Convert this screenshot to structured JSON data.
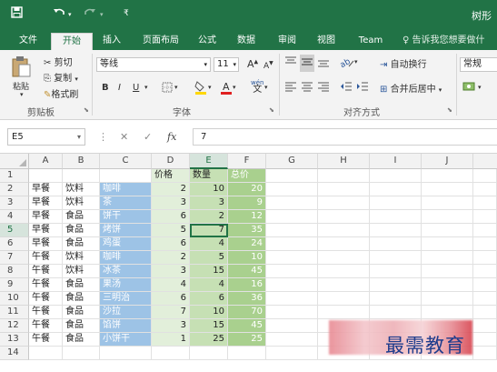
{
  "titlebar": {
    "save_icon": "save-icon",
    "undo_icon": "undo-icon",
    "redo_icon": "redo-icon",
    "customize_icon": "customize-qat-icon",
    "doc_title": "树形"
  },
  "tabs": [
    "文件",
    "开始",
    "插入",
    "页面布局",
    "公式",
    "数据",
    "审阅",
    "视图",
    "Team"
  ],
  "active_tab": "开始",
  "tell_me": "告诉我您想要做什",
  "ribbon": {
    "clipboard": {
      "paste": "粘贴",
      "cut": "剪切",
      "copy": "复制",
      "format_painter": "格式刷",
      "group_label": "剪贴板"
    },
    "font": {
      "font_name": "等线",
      "font_size": "11",
      "grow": "A",
      "shrink": "A",
      "bold": "B",
      "italic": "I",
      "underline": "U",
      "wen": "wén",
      "group_label": "字体"
    },
    "alignment": {
      "wrap_text": "自动换行",
      "merge_center": "合并后居中",
      "group_label": "对齐方式"
    },
    "number": {
      "format": "常规"
    }
  },
  "formula_bar": {
    "name_box": "E5",
    "fx": "fx",
    "value": "7"
  },
  "columns": [
    "A",
    "B",
    "C",
    "D",
    "E",
    "F",
    "G",
    "H",
    "I",
    "J"
  ],
  "selected_column": "E",
  "row_numbers": [
    "1",
    "2",
    "3",
    "4",
    "5",
    "6",
    "7",
    "8",
    "9",
    "10",
    "11",
    "12",
    "13",
    "14"
  ],
  "selected_row": "5",
  "headers": {
    "d": "价格",
    "e": "数量",
    "f": "总价"
  },
  "rows": [
    {
      "a": "早餐",
      "b": "饮料",
      "c": "咖啡",
      "d": "2",
      "e": "10",
      "f": "20"
    },
    {
      "a": "早餐",
      "b": "饮料",
      "c": "茶",
      "d": "3",
      "e": "3",
      "f": "9"
    },
    {
      "a": "早餐",
      "b": "食品",
      "c": "饼干",
      "d": "6",
      "e": "2",
      "f": "12"
    },
    {
      "a": "早餐",
      "b": "食品",
      "c": "烤饼",
      "d": "5",
      "e": "7",
      "f": "35"
    },
    {
      "a": "早餐",
      "b": "食品",
      "c": "鸡蛋",
      "d": "6",
      "e": "4",
      "f": "24"
    },
    {
      "a": "午餐",
      "b": "饮料",
      "c": "咖啡",
      "d": "2",
      "e": "5",
      "f": "10"
    },
    {
      "a": "午餐",
      "b": "饮料",
      "c": "冰茶",
      "d": "3",
      "e": "15",
      "f": "45"
    },
    {
      "a": "午餐",
      "b": "食品",
      "c": "果汤",
      "d": "4",
      "e": "4",
      "f": "16"
    },
    {
      "a": "午餐",
      "b": "食品",
      "c": "三明治",
      "d": "6",
      "e": "6",
      "f": "36"
    },
    {
      "a": "午餐",
      "b": "食品",
      "c": "沙拉",
      "d": "7",
      "e": "10",
      "f": "70"
    },
    {
      "a": "午餐",
      "b": "食品",
      "c": "馅饼",
      "d": "3",
      "e": "15",
      "f": "45"
    },
    {
      "a": "午餐",
      "b": "食品",
      "c": "小饼干",
      "d": "1",
      "e": "25",
      "f": "25"
    }
  ],
  "watermark": "最需教育",
  "colors": {
    "brand": "#217346",
    "col_c": "#9dc3e6",
    "col_e": "#c6e0b4",
    "col_f": "#a9d08e"
  }
}
